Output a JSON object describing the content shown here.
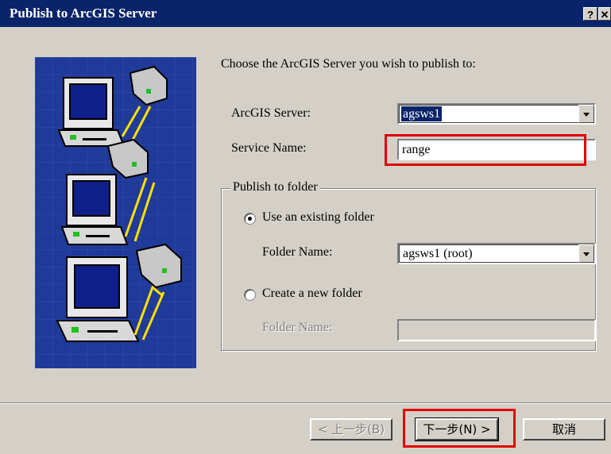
{
  "window": {
    "title": "Publish to ArcGIS Server",
    "help_glyph": "?",
    "close_glyph": "✕"
  },
  "intro": "Choose the ArcGIS Server you wish to publish to:",
  "server": {
    "label": "ArcGIS Server:",
    "value": "agsws1"
  },
  "service": {
    "label": "Service Name:",
    "value": "range"
  },
  "folder_group": {
    "title": "Publish to folder",
    "existing": {
      "label": "Use an existing folder",
      "selected": true,
      "folder_label": "Folder Name:",
      "folder_value": "agsws1 (root)"
    },
    "new": {
      "label": "Create a new folder",
      "selected": false,
      "folder_label": "Folder Name:",
      "folder_value": ""
    }
  },
  "buttons": {
    "back": "< 上一步(B)",
    "next": "下一步(N) >",
    "cancel": "取消"
  },
  "colors": {
    "title_bar": "#0a246a",
    "dialog": "#d4d0c8",
    "art_bg": "#1f3a98",
    "annotation": "#e00000"
  }
}
